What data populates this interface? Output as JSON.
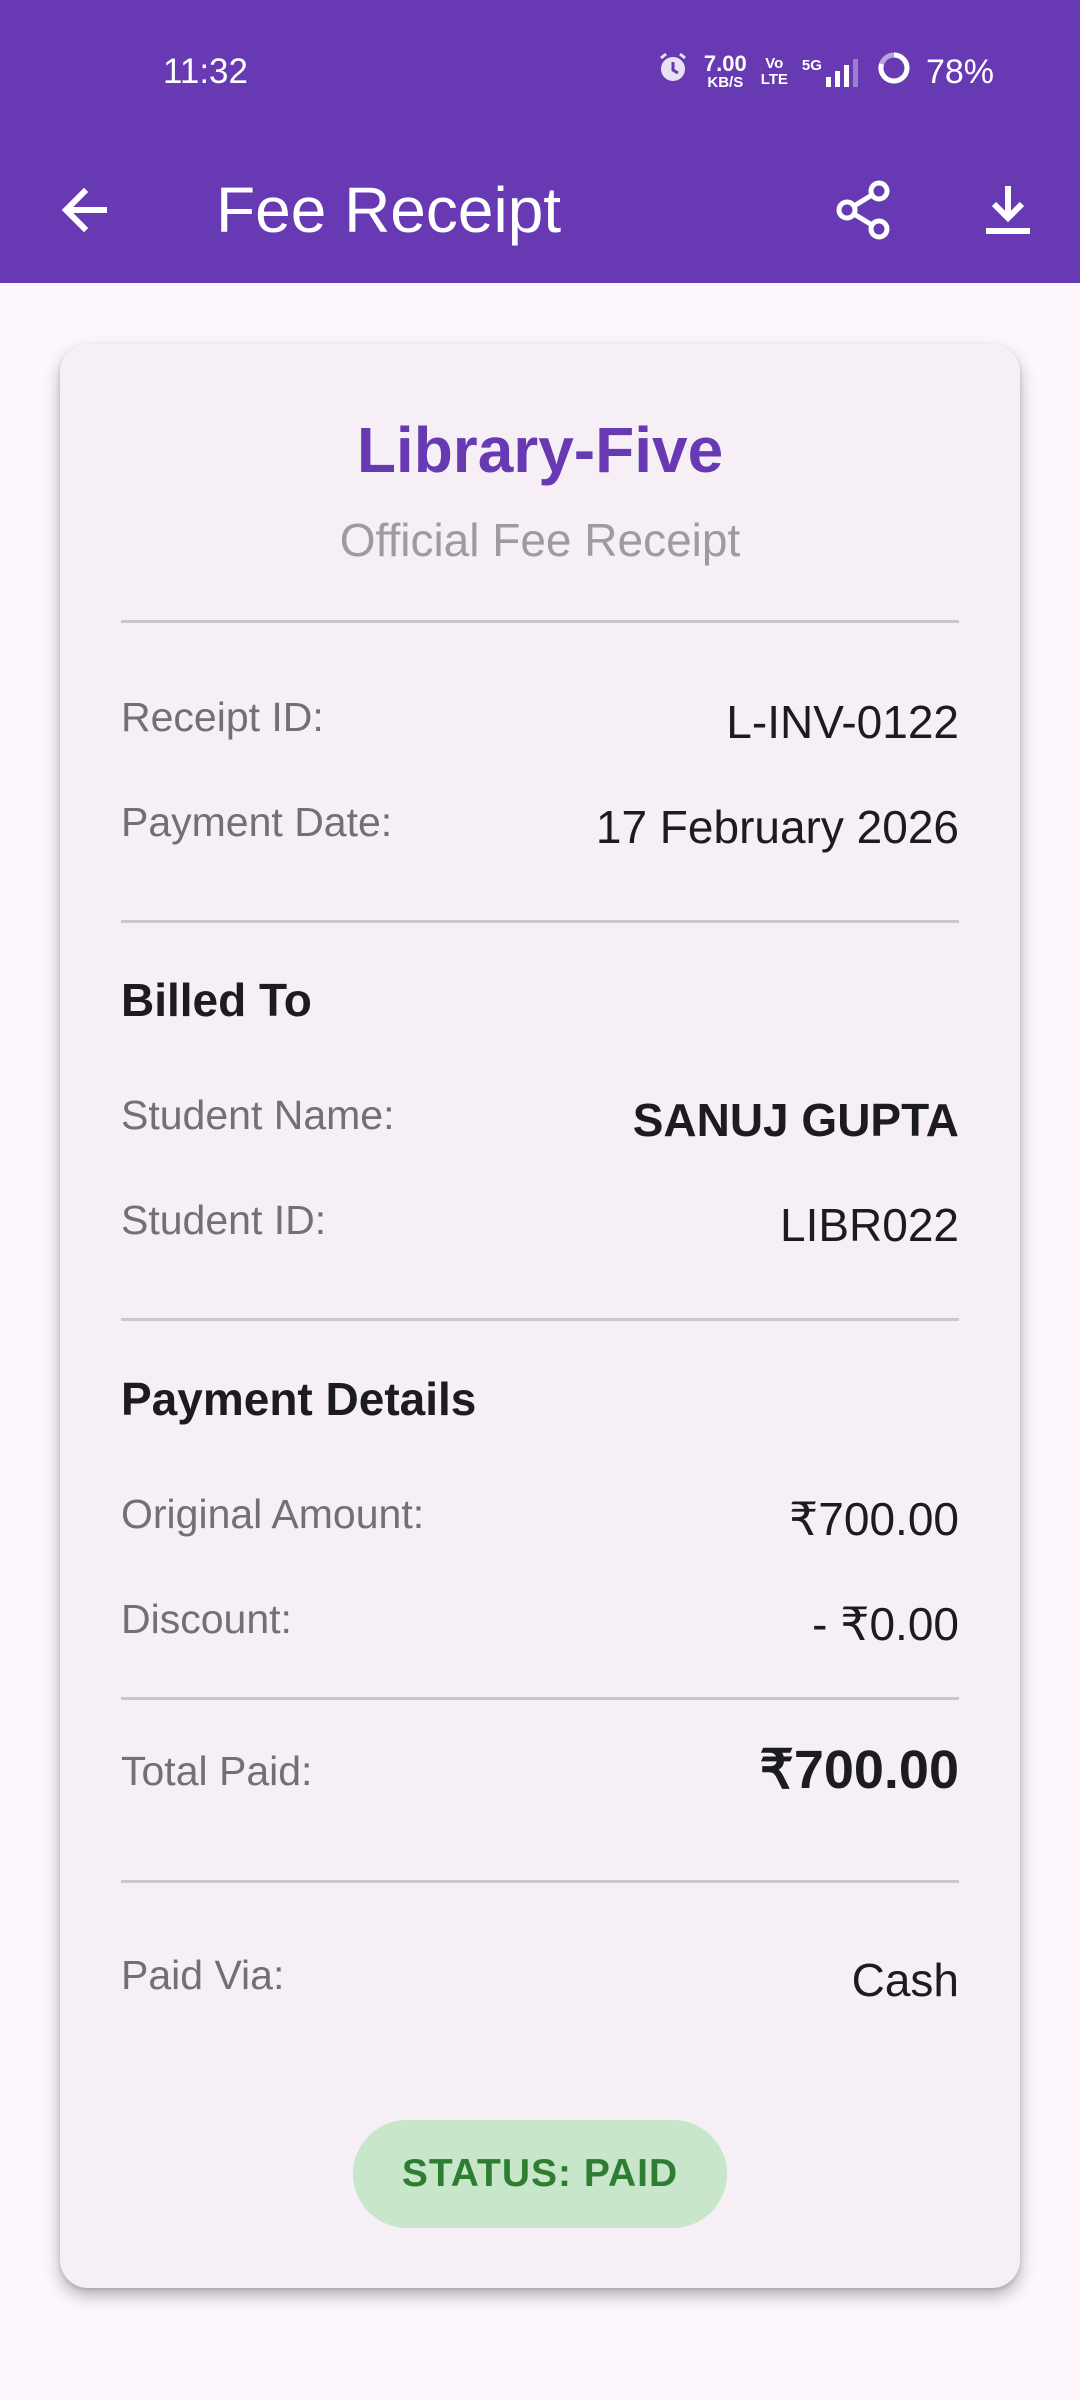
{
  "status_bar": {
    "time": "11:32",
    "net_speed_top": "7.00",
    "net_speed_bottom": "KB/S",
    "volte_top": "Vo",
    "volte_bottom": "LTE",
    "network": "5G",
    "battery": "78%"
  },
  "app_bar": {
    "title": "Fee Receipt",
    "icons": [
      "back-arrow-icon",
      "share-icon",
      "download-icon"
    ]
  },
  "receipt": {
    "library_name": "Library-Five",
    "subtitle": "Official Fee Receipt",
    "receipt_id_label": "Receipt ID:",
    "receipt_id": "L-INV-0122",
    "payment_date_label": "Payment Date:",
    "payment_date": "17 February 2026",
    "billed_to": {
      "title": "Billed To",
      "student_name_label": "Student Name:",
      "student_name": "SANUJ GUPTA",
      "student_id_label": "Student ID:",
      "student_id": "LIBR022"
    },
    "payment_details": {
      "title": "Payment Details",
      "original_amount_label": "Original Amount:",
      "original_amount": "₹700.00",
      "discount_label": "Discount:",
      "discount": "- ₹0.00"
    },
    "total_paid_label": "Total Paid:",
    "total_paid": "₹700.00",
    "paid_via_label": "Paid Via:",
    "paid_via": "Cash",
    "status": "STATUS: PAID"
  },
  "colors": {
    "primary": "#673ab4",
    "status_bg": "#c8e6c9",
    "status_text": "#2e7d32"
  }
}
